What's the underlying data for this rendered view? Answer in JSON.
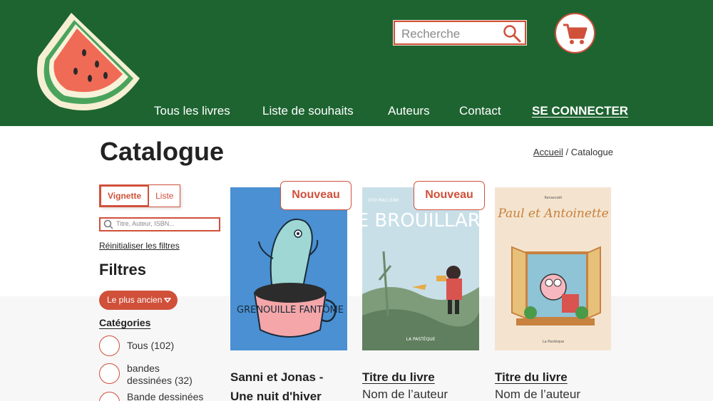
{
  "header": {
    "search_placeholder": "Recherche",
    "nav": [
      "Tous les livres",
      "Liste de souhaits",
      "Auteurs",
      "Contact"
    ],
    "login": "SE CONNECTER",
    "colors": {
      "header_bg": "#1e6431",
      "accent": "#d0503a"
    }
  },
  "page": {
    "title": "Catalogue",
    "breadcrumb": {
      "home": "Accueil",
      "sep": "/",
      "current": "Catalogue"
    }
  },
  "sidebar": {
    "view_toggle": {
      "grid": "Vignette",
      "list": "Liste",
      "active": "Vignette"
    },
    "search_placeholder": "Titre, Auteur, ISBN...",
    "reset": "Réinitialiser les filtres",
    "filters_title": "Filtres",
    "sort": "Le plus ancien",
    "categories_title": "Catégories",
    "categories": [
      {
        "label": "Tous (102)"
      },
      {
        "label": "bandes dessinées (32)"
      },
      {
        "label": "Bande dessinées"
      }
    ]
  },
  "books": [
    {
      "badge": "Nouveau",
      "title": "Sanni et Jonas - Une nuit d'hiver",
      "cover_text": "GRENOUILLE FANTÔME"
    },
    {
      "badge": "Nouveau",
      "title": "Titre du livre",
      "author": "Nom de l’auteur",
      "cover_text": "LE BROUILLARD",
      "cover_author": "KYO MACLEAR",
      "cover_publisher": "LA PASTÈQUE"
    },
    {
      "title": "Titre du livre",
      "author": "Nom de l’auteur",
      "cover_text": "Paul et Antoinette",
      "cover_author": "Kerascoët",
      "cover_publisher": "La Pastèque"
    }
  ]
}
